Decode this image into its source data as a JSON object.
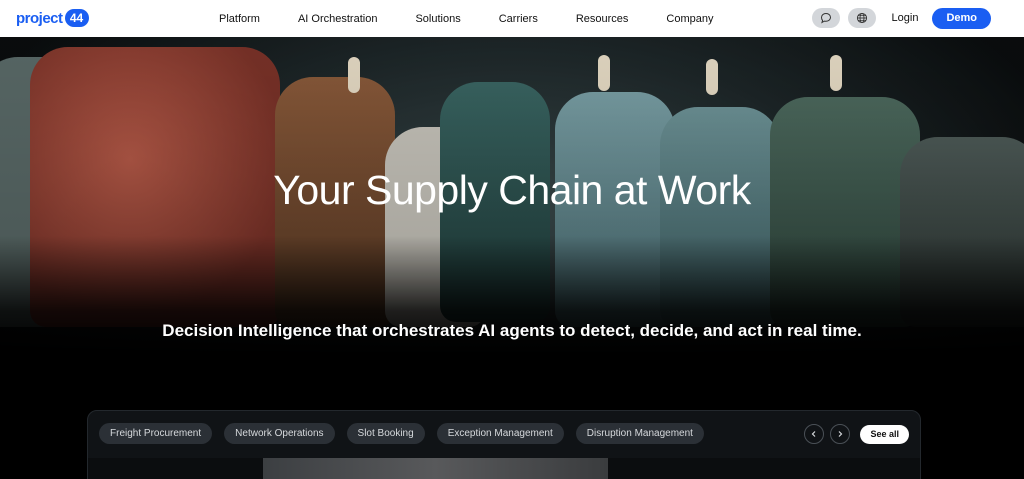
{
  "nav": {
    "logo_word": "project",
    "logo_number": "44",
    "menu": [
      "Platform",
      "AI Orchestration",
      "Solutions",
      "Carriers",
      "Resources",
      "Company"
    ],
    "chat_icon": "chat-bubble-icon",
    "globe_icon": "globe-icon",
    "login_label": "Login",
    "demo_label": "Demo"
  },
  "hero": {
    "headline": "Your Supply Chain at Work",
    "subhead": "Decision Intelligence that orchestrates AI agents to detect, decide, and act in real time."
  },
  "panel": {
    "chips": [
      "Freight Procurement",
      "Network Operations",
      "Slot Booking",
      "Exception Management",
      "Disruption Management"
    ],
    "prev_icon": "chevron-left-icon",
    "next_icon": "chevron-right-icon",
    "see_all_label": "See all"
  },
  "colors": {
    "brand_blue": "#1a5ef2",
    "chip_bg": "#2b3036",
    "panel_bg": "#101316"
  }
}
